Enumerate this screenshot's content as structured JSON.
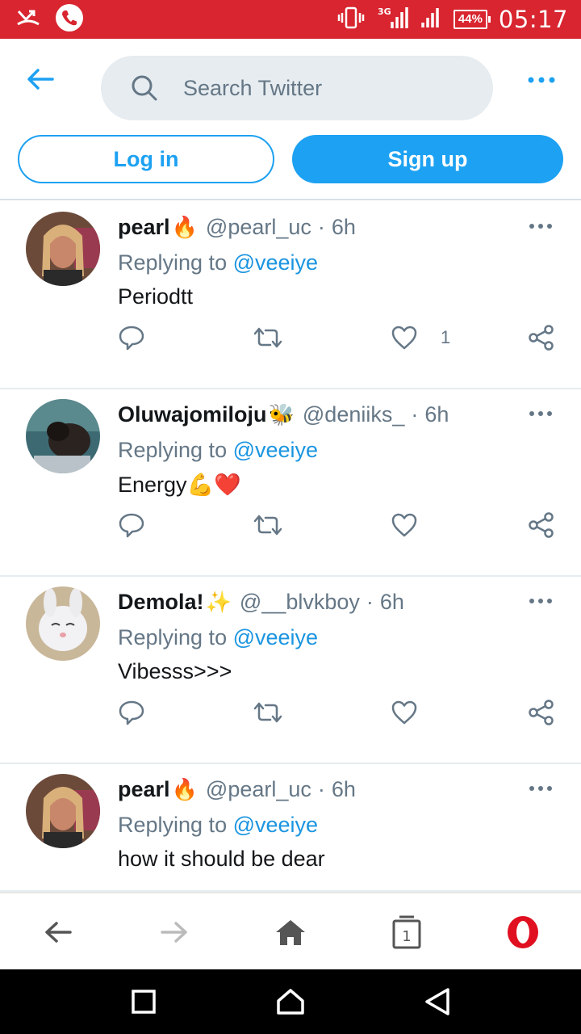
{
  "status_bar": {
    "battery": "44%",
    "time": "05:17",
    "network": "3G",
    "color": "#d8252f",
    "icons": [
      "missed-call-icon",
      "phone-icon",
      "vibrate-icon",
      "signal-3g-icon",
      "signal-icon",
      "battery-icon"
    ]
  },
  "header": {
    "search_placeholder": "Search Twitter",
    "login_label": "Log in",
    "signup_label": "Sign up",
    "accent_color": "#1da1f2"
  },
  "tweets": [
    {
      "name": "pearl",
      "emoji": "🔥",
      "handle": "@pearl_uc",
      "sep": "·",
      "time": "6h",
      "replying_prefix": "Replying to",
      "replying_to": "@veeiye",
      "text": "Periodtt",
      "like_count": "1",
      "avatar": "avatar-girl-braids"
    },
    {
      "name": "Oluwajomiloju",
      "emoji": "🐝",
      "handle": "@deniiks_",
      "sep": "·",
      "time": "6h",
      "replying_prefix": "Replying to",
      "replying_to": "@veeiye",
      "text": "Energy💪❤️",
      "like_count": "",
      "avatar": "avatar-dark-photo"
    },
    {
      "name": "Demola!",
      "emoji": "✨",
      "handle": "@__blvkboy",
      "sep": "·",
      "time": "6h",
      "replying_prefix": "Replying to",
      "replying_to": "@veeiye",
      "text": "Vibesss>>>",
      "like_count": "",
      "avatar": "avatar-bunny"
    },
    {
      "name": "pearl",
      "emoji": "🔥",
      "handle": "@pearl_uc",
      "sep": "·",
      "time": "6h",
      "replying_prefix": "Replying to",
      "replying_to": "@veeiye",
      "text": "how it should be dear",
      "like_count": "",
      "avatar": "avatar-girl-braids"
    }
  ],
  "browser_bar": {
    "tab_count": "1"
  }
}
